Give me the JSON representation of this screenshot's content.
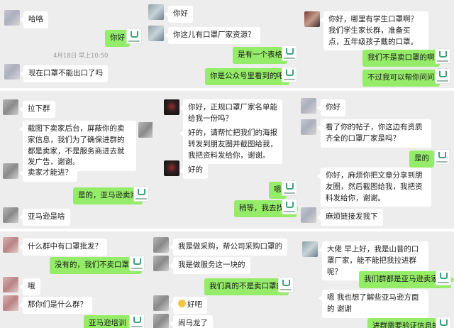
{
  "panel1": {
    "timestamp": "4月18日 早上10:50",
    "messages": [
      {
        "dir": "in",
        "text": "哈咯"
      },
      {
        "dir": "out",
        "text": "你好"
      },
      {
        "dir": "in",
        "text": "现在口罩不能出口了吗"
      }
    ]
  },
  "panel2": {
    "messages": [
      {
        "dir": "in",
        "text": "你好"
      },
      {
        "dir": "in",
        "text": "你这儿有口罩厂家资源？"
      },
      {
        "dir": "out",
        "text": "是有一个表格"
      },
      {
        "dir": "out",
        "text": "你是公众号里看到的吧"
      }
    ]
  },
  "panel3": {
    "messages": [
      {
        "dir": "in",
        "text": "你好，哪里有学生口罩啊？我们学生家长群，准备买点，五年级孩子戴的口罩。"
      },
      {
        "dir": "out",
        "text": "我们不是卖口罩的啊"
      },
      {
        "dir": "out",
        "text": "不过我可以帮你问问"
      }
    ]
  },
  "panel4": {
    "messages": [
      {
        "dir": "in",
        "text": "拉下群"
      },
      {
        "dir": "in",
        "text": "截图下卖家后台，屏蔽你的卖家信息，我们为了确保进群的都是卖家，不是服务商进去就发广告，谢谢。"
      },
      {
        "dir": "in",
        "text": "卖家才能进？"
      },
      {
        "dir": "out",
        "text": "是的，亚马逊卖家"
      },
      {
        "dir": "in",
        "text": "亚马逊是啥"
      }
    ]
  },
  "panel5": {
    "messages": [
      {
        "dir": "in",
        "text": "你好，正规口罩厂家名单能给我一份吗？"
      },
      {
        "dir": "in",
        "text": "好的，请帮忙把我们的海报转发到朋友圈并截图给我，我把资料发给你，谢谢。"
      },
      {
        "dir": "in",
        "text": "好的"
      },
      {
        "dir": "out",
        "text": "嗯"
      },
      {
        "dir": "out",
        "text": "稍等，我去找下"
      }
    ]
  },
  "panel6": {
    "messages": [
      {
        "dir": "in",
        "text": "你好"
      },
      {
        "dir": "in",
        "text": "看了你的帖子，你这边有资质齐全的口罩厂家是吗？"
      },
      {
        "dir": "out",
        "text": "是的"
      },
      {
        "dir": "in",
        "text": "你好，麻烦你把文章分享到朋友圈，然后截图给我，我把资料发给你，谢谢。"
      },
      {
        "dir": "in",
        "text": "麻烦链接发我下"
      }
    ]
  },
  "panel7": {
    "messages": [
      {
        "dir": "in",
        "text": "什么群中有口罩批发？"
      },
      {
        "dir": "out",
        "text": "没有的，我们不卖口罩的"
      },
      {
        "dir": "in",
        "text": "哦"
      },
      {
        "dir": "in",
        "text": "那你们是什么群？"
      },
      {
        "dir": "out",
        "text": "亚马逊培训"
      }
    ]
  },
  "panel8": {
    "messages": [
      {
        "dir": "in",
        "text": "我是做采购，帮公司采购口罩的"
      },
      {
        "dir": "in",
        "text": "我是做服务这一块的"
      },
      {
        "dir": "out",
        "text": "我们真的不是卖口罩的"
      },
      {
        "dir": "in",
        "text": "好吧"
      },
      {
        "dir": "in",
        "text": "闹乌龙了"
      }
    ]
  },
  "panel9": {
    "messages": [
      {
        "dir": "in",
        "text": "大佬 早上好，我是山普的口罩厂家，能不能把我拉进群呢？"
      },
      {
        "dir": "out",
        "text": "我们群都是亚马逊卖家哦"
      },
      {
        "dir": "in",
        "text": "嗯 我也想了解些亚马逊方面的 谢谢"
      },
      {
        "dir": "out",
        "text": "进群需要验证信息的"
      }
    ]
  },
  "icons": {
    "self_avatar": "brand-logo-avatar",
    "contact_avatar": "blurred-avatar",
    "emoji": "smile-emoji-icon"
  },
  "colors": {
    "panel_bg": "#ededed",
    "incoming_bubble": "#ffffff",
    "outgoing_bubble": "#95ec69",
    "timestamp": "#999999"
  }
}
